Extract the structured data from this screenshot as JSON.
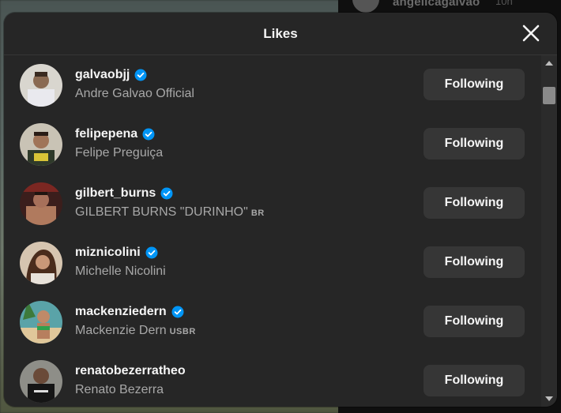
{
  "background": {
    "top_username": "angelicagalvao",
    "top_time": "10h"
  },
  "modal": {
    "title": "Likes",
    "close_icon": "close-icon"
  },
  "users": [
    {
      "username": "galvaobjj",
      "full_name": "Andre Galvao Official",
      "flag": "",
      "verified": true,
      "button": "Following"
    },
    {
      "username": "felipepena",
      "full_name": "Felipe Preguiça",
      "flag": "",
      "verified": true,
      "button": "Following"
    },
    {
      "username": "gilbert_burns",
      "full_name": "GILBERT BURNS \"DURINHO\"",
      "flag": "BR",
      "verified": true,
      "button": "Following"
    },
    {
      "username": "miznicolini",
      "full_name": "Michelle Nicolini",
      "flag": "",
      "verified": true,
      "button": "Following"
    },
    {
      "username": "mackenziedern",
      "full_name": "Mackenzie Dern",
      "flag": "USBR",
      "verified": true,
      "button": "Following"
    },
    {
      "username": "renatobezerratheo",
      "full_name": "Renato Bezerra",
      "flag": "",
      "verified": false,
      "button": "Following"
    }
  ],
  "colors": {
    "modal_bg": "#262626",
    "button_bg": "#363636",
    "verified_blue": "#0095f6",
    "text_primary": "#f5f5f5",
    "text_secondary": "#a8a8a8"
  }
}
